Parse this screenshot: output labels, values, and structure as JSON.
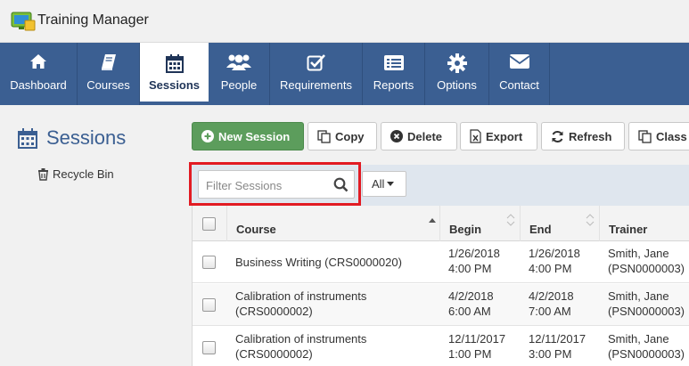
{
  "app": {
    "title": "Training Manager"
  },
  "nav": [
    {
      "label": "Dashboard",
      "icon": "home-icon"
    },
    {
      "label": "Courses",
      "icon": "book-icon"
    },
    {
      "label": "Sessions",
      "icon": "calendar-icon",
      "active": true
    },
    {
      "label": "People",
      "icon": "people-icon"
    },
    {
      "label": "Requirements",
      "icon": "checkbox-icon"
    },
    {
      "label": "Reports",
      "icon": "list-icon"
    },
    {
      "label": "Options",
      "icon": "gear-icon"
    },
    {
      "label": "Contact",
      "icon": "envelope-icon"
    }
  ],
  "sidebar": {
    "title": "Sessions",
    "recycle_bin": "Recycle Bin"
  },
  "toolbar": {
    "new_session": "New Session",
    "copy": "Copy",
    "delete": "Delete",
    "export": "Export",
    "refresh": "Refresh",
    "class": "Class"
  },
  "filter": {
    "placeholder": "Filter Sessions",
    "dropdown": "All"
  },
  "table": {
    "columns": [
      "Course",
      "Begin",
      "End",
      "Trainer"
    ],
    "rows": [
      {
        "course": [
          "Business Writing (CRS0000020)"
        ],
        "begin": [
          "1/26/2018",
          "4:00 PM"
        ],
        "end": [
          "1/26/2018",
          "4:00 PM"
        ],
        "trainer": [
          "Smith, Jane",
          "(PSN0000003)"
        ]
      },
      {
        "course": [
          "Calibration of instruments",
          "(CRS0000002)"
        ],
        "begin": [
          "4/2/2018",
          "6:00 AM"
        ],
        "end": [
          "4/2/2018",
          "7:00 AM"
        ],
        "trainer": [
          "Smith, Jane",
          "(PSN0000003)"
        ]
      },
      {
        "course": [
          "Calibration of instruments",
          "(CRS0000002)"
        ],
        "begin": [
          "12/11/2017",
          "1:00 PM"
        ],
        "end": [
          "12/11/2017",
          "3:00 PM"
        ],
        "trainer": [
          "Smith, Jane",
          "(PSN0000003)"
        ]
      }
    ]
  },
  "colors": {
    "nav_bg": "#3b5f92",
    "primary_btn": "#5c9d5c",
    "highlight": "#e21b23"
  }
}
